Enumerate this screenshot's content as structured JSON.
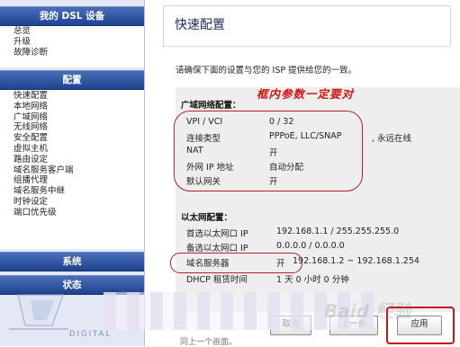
{
  "sidebar": {
    "header_device": "我的 DSL 设备",
    "device_items": [
      "总览",
      "升级",
      "故障诊断"
    ],
    "header_config": "配置",
    "config_items": [
      "快速配置",
      "本地网络",
      "广域网络",
      "无线网络",
      "安全配置",
      "虚拟主机",
      "路由设定",
      "域名服务客户端",
      "组播代理",
      "域名服务中继",
      "时钟设定",
      "端口优先级"
    ],
    "header_system": "系统",
    "header_status": "状态",
    "logo_text": "DIGITAL"
  },
  "main": {
    "title": "快速配置",
    "description": "请确保下面的设置与您的 ISP 提供给您的一致。",
    "hand_note": "框内参数一定要对",
    "wan_title": "广域网络配置：",
    "wan": {
      "vpi_label": "VPI / VCI",
      "vpi_value": "0 / 32",
      "conn_label": "连接类型",
      "conn_value": "PPPoE,  LLC/SNAP",
      "conn_extra": ", 永远在线",
      "nat_label": "NAT",
      "nat_value": "开",
      "ip_label": "外网 IP 地址",
      "ip_value": "自动分配",
      "gw_label": "默认网关",
      "gw_value": "开"
    },
    "lan_title": "以太网配置：",
    "lan": {
      "primary_label": "首选以太网口 IP",
      "primary_value": "192.168.1.1 / 255.255.255.0",
      "secondary_label": "备选以太网口 IP",
      "secondary_value": "0.0.0.0 / 0.0.0.0",
      "dns_label": "域名服务器",
      "dns_value": "开",
      "dns_range": "192.168.1.2 ~ 192.168.1.254",
      "dhcp_label": "DHCP 租赁时间",
      "dhcp_value": "1 天 0 小时 0 分钟"
    },
    "buttons": {
      "cancel": "取消",
      "back": "上一步",
      "apply": "应用"
    },
    "watermark": "Baid 经验",
    "bottom_note": "同上一个画面。"
  }
}
